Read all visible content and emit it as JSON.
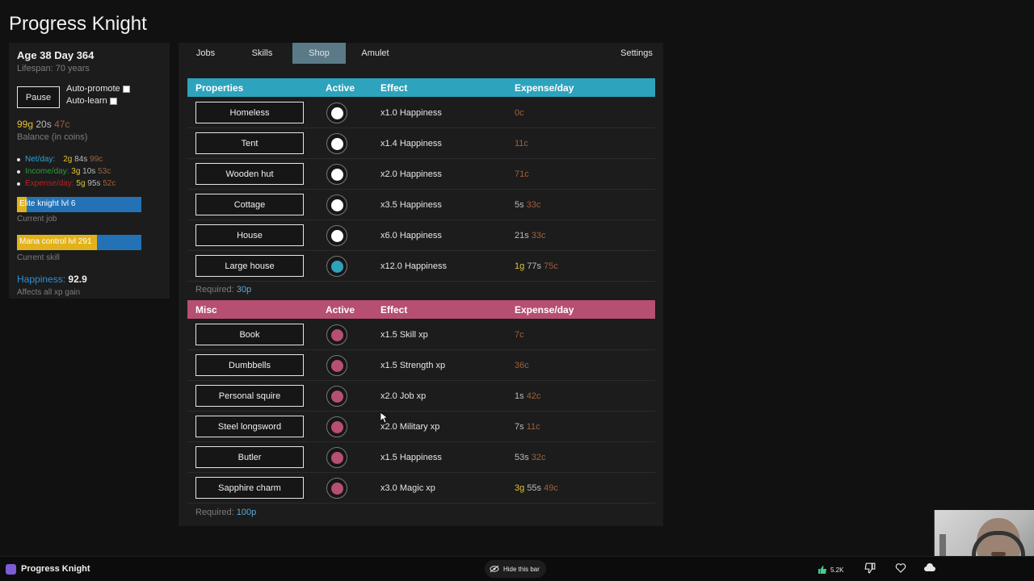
{
  "app": {
    "title": "Progress Knight"
  },
  "sidebar": {
    "age": "Age 38 Day 364",
    "lifespan": "Lifespan: 70 years",
    "pause_label": "Pause",
    "auto_promote_label": "Auto-promote",
    "auto_learn_label": "Auto-learn",
    "balance": {
      "gold": "99g",
      "silver": "20s",
      "copper": "47c"
    },
    "balance_label": "Balance (in coins)",
    "net": {
      "label": "Net/day:",
      "gold": "2g",
      "silver": "84s",
      "copper": "99c"
    },
    "income": {
      "label": "Income/day:",
      "gold": "3g",
      "silver": "10s",
      "copper": "53c"
    },
    "expense": {
      "label": "Expense/day:",
      "gold": "5g",
      "silver": "95s",
      "copper": "52c"
    },
    "job_bar": {
      "label": "Elite knight lvl 6",
      "progress": 0.08,
      "caption": "Current job"
    },
    "skill_bar": {
      "label": "Mana control lvl 291",
      "progress": 0.64,
      "caption": "Current skill"
    },
    "happiness": {
      "label": "Happiness:",
      "value": "92.9",
      "caption": "Affects all xp gain"
    }
  },
  "tabs": [
    {
      "label": "Jobs"
    },
    {
      "label": "Skills"
    },
    {
      "label": "Shop",
      "active": true
    },
    {
      "label": "Amulet"
    },
    {
      "label": "Settings"
    }
  ],
  "properties": {
    "headers": {
      "name": "Properties",
      "active": "Active",
      "effect": "Effect",
      "expense": "Expense/day"
    },
    "items": [
      {
        "name": "Homeless",
        "active": false,
        "effect": "x1.0 Happiness",
        "gold": "",
        "silver": "",
        "copper": "0c"
      },
      {
        "name": "Tent",
        "active": false,
        "effect": "x1.4 Happiness",
        "gold": "",
        "silver": "",
        "copper": "11c"
      },
      {
        "name": "Wooden hut",
        "active": false,
        "effect": "x2.0 Happiness",
        "gold": "",
        "silver": "",
        "copper": "71c"
      },
      {
        "name": "Cottage",
        "active": false,
        "effect": "x3.5 Happiness",
        "gold": "",
        "silver": "5s",
        "copper": "33c"
      },
      {
        "name": "House",
        "active": false,
        "effect": "x6.0 Happiness",
        "gold": "",
        "silver": "21s",
        "copper": "33c"
      },
      {
        "name": "Large house",
        "active": true,
        "effect": "x12.0 Happiness",
        "gold": "1g",
        "silver": "77s",
        "copper": "75c"
      }
    ],
    "required_label": "Required:",
    "required_value": "30p"
  },
  "misc": {
    "headers": {
      "name": "Misc",
      "active": "Active",
      "effect": "Effect",
      "expense": "Expense/day"
    },
    "items": [
      {
        "name": "Book",
        "active": true,
        "effect": "x1.5 Skill xp",
        "gold": "",
        "silver": "",
        "copper": "7c"
      },
      {
        "name": "Dumbbells",
        "active": true,
        "effect": "x1.5 Strength xp",
        "gold": "",
        "silver": "",
        "copper": "36c"
      },
      {
        "name": "Personal squire",
        "active": true,
        "effect": "x2.0 Job xp",
        "gold": "",
        "silver": "1s",
        "copper": "42c"
      },
      {
        "name": "Steel longsword",
        "active": true,
        "effect": "x2.0 Military xp",
        "gold": "",
        "silver": "7s",
        "copper": "11c"
      },
      {
        "name": "Butler",
        "active": true,
        "effect": "x1.5 Happiness",
        "gold": "",
        "silver": "53s",
        "copper": "32c"
      },
      {
        "name": "Sapphire charm",
        "active": true,
        "effect": "x3.0 Magic xp",
        "gold": "3g",
        "silver": "55s",
        "copper": "49c"
      }
    ],
    "required_label": "Required:",
    "required_value": "100p"
  },
  "colors": {
    "properties_accent": "#2ea3bd",
    "misc_accent": "#b64f72",
    "gold": "#e4c232",
    "silver": "#bbbbbb",
    "copper": "#a0603c",
    "inactive_dot": "#ffffff",
    "active_properties_dot": "#2ea3bd",
    "active_misc_dot": "#b64f72"
  },
  "bottom_bar": {
    "title": "Progress Knight",
    "hide_label": "Hide this bar",
    "likes": "5.2K",
    "icons": [
      "thumbs-up-icon",
      "thumbs-down-icon",
      "heart-icon",
      "cloud-icon"
    ]
  }
}
